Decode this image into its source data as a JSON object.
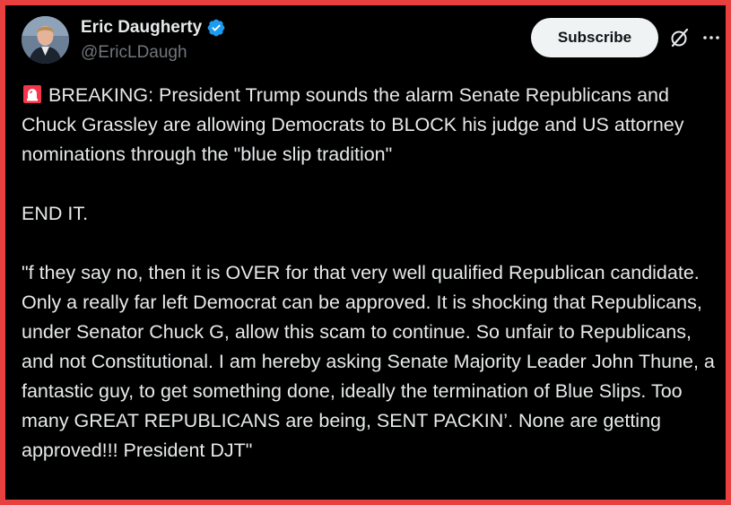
{
  "author": {
    "display_name": "Eric Daugherty",
    "handle": "@EricLDaugh",
    "verified": true
  },
  "actions": {
    "subscribe_label": "Subscribe",
    "grok_icon": "grok-slash-icon",
    "more_icon": "more-dots-icon"
  },
  "tweet": {
    "line1_emoji": "siren-icon",
    "paragraph1": "BREAKING: President Trump sounds the alarm Senate Republicans and Chuck Grassley are allowing Democrats to BLOCK his judge and US attorney nominations through the \"blue slip tradition\"",
    "paragraph2": "END IT.",
    "paragraph3": "\"f they say no, then it is OVER for that very well qualified Republican candidate. Only a really far left Democrat can be approved. It is shocking that Republicans, under Senator Chuck G, allow this scam to continue. So unfair to Republicans, and not Constitutional. I am hereby asking Senate Majority Leader John Thune, a fantastic guy, to get something done, ideally the termination of Blue Slips. Too many GREAT REPUBLICANS are being, SENT PACKIN’. None are getting approved!!! President DJT\""
  },
  "colors": {
    "frame_border": "#e8403f",
    "background": "#000000",
    "text_primary": "#e7e9ea",
    "text_secondary": "#71767b",
    "verified_blue": "#1d9bf0",
    "button_bg": "#eff3f4"
  }
}
